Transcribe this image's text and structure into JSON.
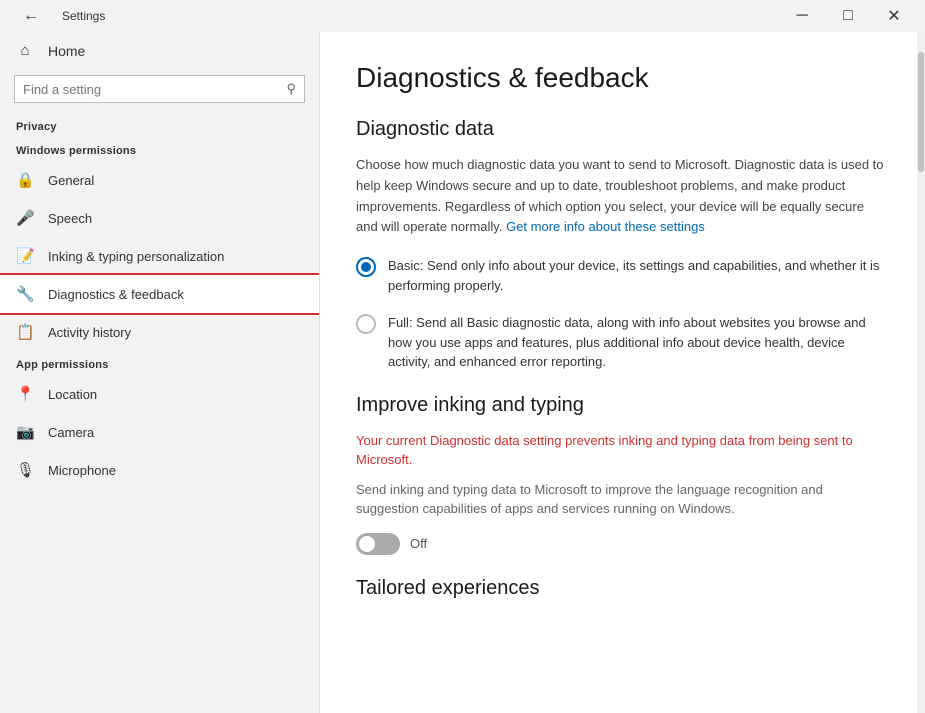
{
  "titlebar": {
    "back_icon": "←",
    "title": "Settings",
    "minimize_icon": "─",
    "maximize_icon": "□",
    "close_icon": "✕"
  },
  "sidebar": {
    "home_label": "Home",
    "search_placeholder": "Find a setting",
    "search_icon": "🔍",
    "privacy_label": "Privacy",
    "windows_permissions_label": "Windows permissions",
    "items_windows": [
      {
        "id": "general",
        "label": "General",
        "icon": "🔒"
      },
      {
        "id": "speech",
        "label": "Speech",
        "icon": "🎤"
      },
      {
        "id": "inking",
        "label": "Inking & typing personalization",
        "icon": "📝"
      },
      {
        "id": "diagnostics",
        "label": "Diagnostics & feedback",
        "icon": "🔧",
        "active": true
      },
      {
        "id": "activity",
        "label": "Activity history",
        "icon": "📋"
      }
    ],
    "app_permissions_label": "App permissions",
    "items_app": [
      {
        "id": "location",
        "label": "Location",
        "icon": "📍"
      },
      {
        "id": "camera",
        "label": "Camera",
        "icon": "📷"
      },
      {
        "id": "microphone",
        "label": "Microphone",
        "icon": "🎙"
      }
    ]
  },
  "main": {
    "title": "Diagnostics & feedback",
    "diagnostic_data": {
      "section_title": "Diagnostic data",
      "description": "Choose how much diagnostic data you want to send to Microsoft. Diagnostic data is used to help keep Windows secure and up to date, troubleshoot problems, and make product improvements. Regardless of which option you select, your device will be equally secure and will operate normally.",
      "link_text": "Get more info about these settings",
      "options": [
        {
          "id": "basic",
          "selected": true,
          "label": "Basic: Send only info about your device, its settings and capabilities, and whether it is performing properly."
        },
        {
          "id": "full",
          "selected": false,
          "label": "Full: Send all Basic diagnostic data, along with info about websites you browse and how you use apps and features, plus additional info about device health, device activity, and enhanced error reporting."
        }
      ]
    },
    "improve_inking": {
      "section_title": "Improve inking and typing",
      "warning": "Your current Diagnostic data setting prevents inking and typing data from being sent to Microsoft.",
      "description": "Send inking and typing data to Microsoft to improve the language recognition and suggestion capabilities of apps and services running on Windows.",
      "toggle_state": "off",
      "toggle_label": "Off"
    },
    "tailored": {
      "section_title": "Tailored experiences"
    }
  }
}
